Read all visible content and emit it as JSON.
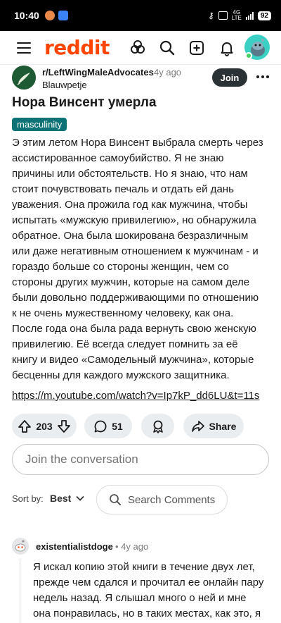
{
  "status_bar": {
    "time": "10:40",
    "network": "4G",
    "lte": "LTE",
    "battery": "92"
  },
  "header": {
    "logo_text": "reddit",
    "accent_color": "#ff4500"
  },
  "post": {
    "subreddit": "r/LeftWingMaleAdvocates",
    "age": "4y ago",
    "author": "Blauwpetje",
    "join_label": "Join",
    "title": "Нора Винсент умерла",
    "flair": "masculinity",
    "body_lines": [
      "Э этим летом Нора Винсент выбрала смерть через",
      "ассистированное самоубийство. Я не знаю",
      "причины или обстоятельств. Но я знаю, что нам",
      "стоит почувствовать печаль и отдать ей дань",
      "уважения. Она прожила год как мужчина, чтобы",
      "испытать «мужскую привилегию», но обнаружила",
      "обратное. Она была шокирована безразличным",
      "или даже негативным отношением к мужчинам - и",
      "гораздо больше со стороны женщин, чем со",
      "стороны других мужчин, которые на самом деле",
      "были довольно поддерживающими по отношению",
      "к не очень мужественному человеку, как она.",
      "После года она была рада вернуть свою женскую",
      "привилегию. Её всегда следует помнить за её",
      "книгу и видео «Самодельный мужчина», которые",
      "бесценны для каждого мужского защитника."
    ],
    "link": "https://m.youtube.com/watch?v=Ip7kP_dd6LU&t=11s",
    "votes": "203",
    "comments_count": "51",
    "share_label": "Share"
  },
  "comment_box": {
    "placeholder": "Join the conversation"
  },
  "sort": {
    "label": "Sort by:",
    "value": "Best",
    "search_label": "Search Comments"
  },
  "comment": {
    "author": "existentialistdoge",
    "age": "• 4y ago",
    "lines": [
      "Я искал копию этой книги в течение двух лет,",
      "прежде чем сдался и прочитал ее онлайн пару",
      "недель назад. Я слышал много о ней и мне",
      "она понравилась, но в таких местах, как это, я"
    ]
  }
}
